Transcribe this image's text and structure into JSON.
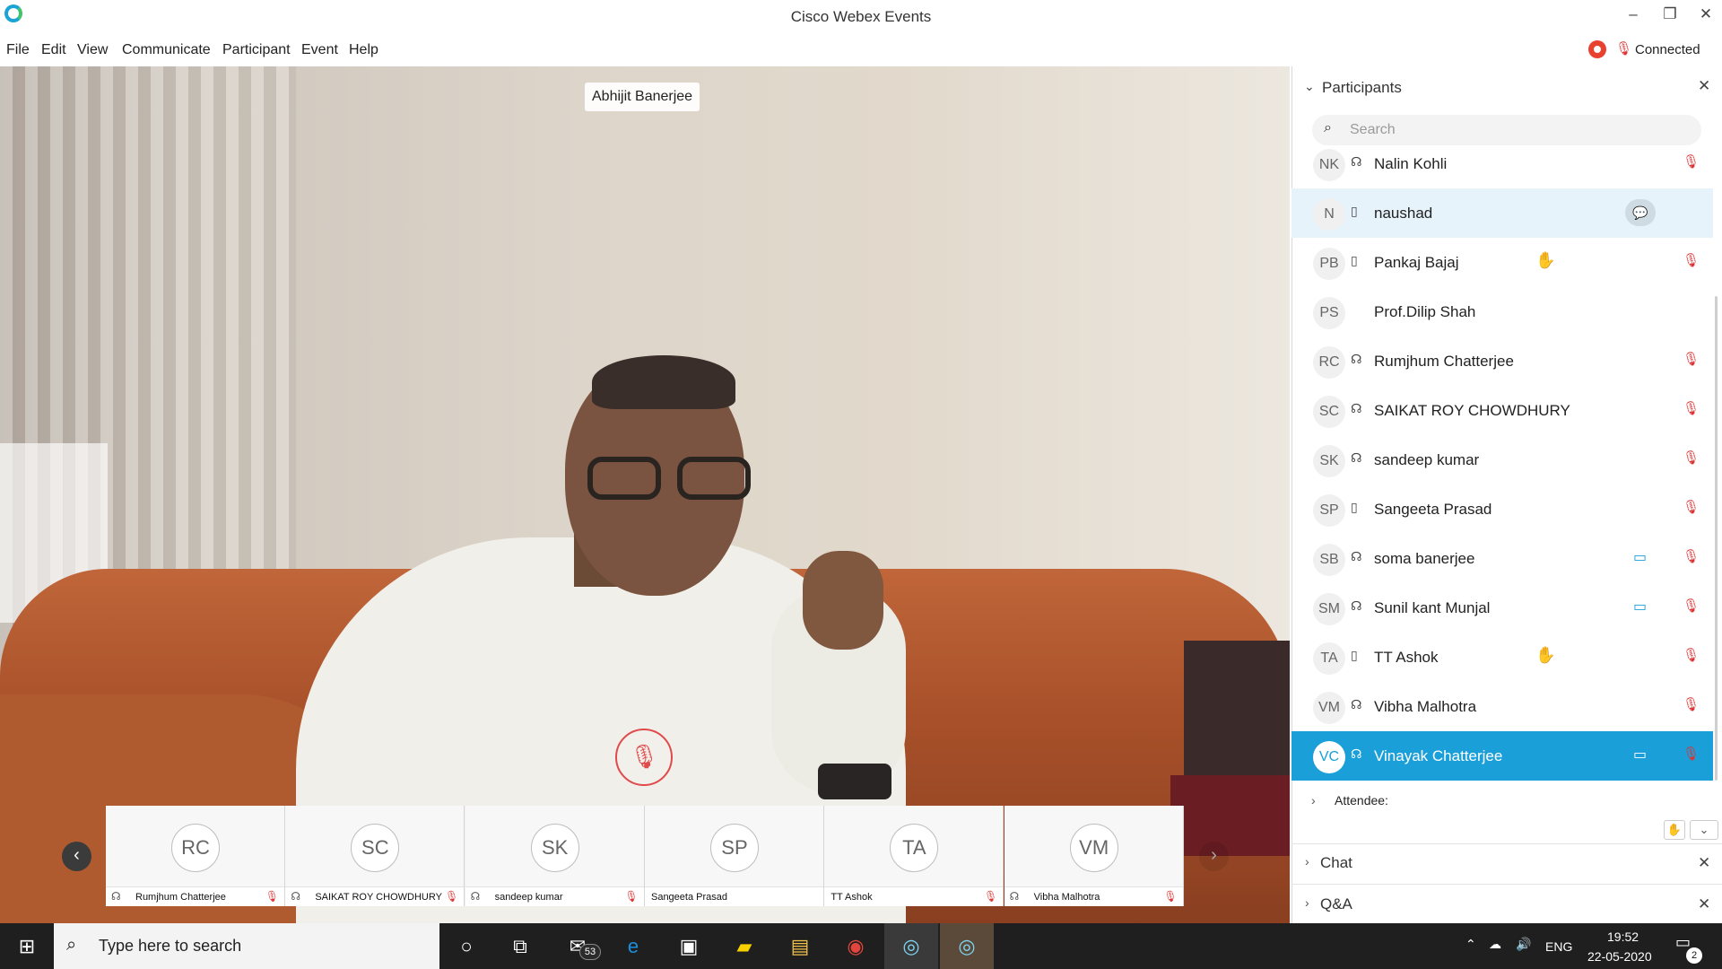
{
  "window": {
    "title": "Cisco Webex Events",
    "minimize": "–",
    "maximize": "❐",
    "close": "✕"
  },
  "menu": [
    "File",
    "Edit",
    "View",
    "Communicate",
    "Participant",
    "Event",
    "Help"
  ],
  "status": {
    "connection": "Connected"
  },
  "video": {
    "speaker_name": "Abhijit Banerjee",
    "mute_icon": "mic-muted"
  },
  "filmstrip": {
    "prev": "‹",
    "next": "›",
    "tiles": [
      {
        "initials": "RC",
        "name": "Rumjhum Chatterjee",
        "audio": "☊",
        "mic": "🎙"
      },
      {
        "initials": "SC",
        "name": "SAIKAT ROY CHOWDHURY",
        "audio": "☊",
        "mic": "🎙"
      },
      {
        "initials": "SK",
        "name": "sandeep kumar",
        "audio": "☊",
        "mic": "🎙"
      },
      {
        "initials": "SP",
        "name": "Sangeeta Prasad",
        "audio": "",
        "mic": ""
      },
      {
        "initials": "TA",
        "name": "TT Ashok",
        "audio": "",
        "mic": "🎙"
      },
      {
        "initials": "VM",
        "name": "Vibha Malhotra",
        "audio": "☊",
        "mic": "🎙"
      }
    ]
  },
  "participants_panel": {
    "title": "Participants",
    "search_placeholder": "Search",
    "participants": [
      {
        "initials": "NK",
        "name": "Nalin Kohli",
        "device": "☊",
        "hand": "",
        "video": "",
        "mic": "🎙",
        "chat": ""
      },
      {
        "initials": "N",
        "name": "naushad",
        "device": "▯",
        "hand": "",
        "video": "",
        "mic": "",
        "chat": "💬"
      },
      {
        "initials": "PB",
        "name": "Pankaj Bajaj",
        "device": "▯",
        "hand": "✋",
        "video": "",
        "mic": "🎙",
        "chat": ""
      },
      {
        "initials": "PS",
        "name": "Prof.Dilip Shah",
        "device": "",
        "hand": "",
        "video": "",
        "mic": "",
        "chat": ""
      },
      {
        "initials": "RC",
        "name": "Rumjhum Chatterjee",
        "device": "☊",
        "hand": "",
        "video": "",
        "mic": "🎙",
        "chat": ""
      },
      {
        "initials": "SC",
        "name": "SAIKAT ROY CHOWDHURY",
        "device": "☊",
        "hand": "",
        "video": "",
        "mic": "🎙",
        "chat": ""
      },
      {
        "initials": "SK",
        "name": "sandeep kumar",
        "device": "☊",
        "hand": "",
        "video": "",
        "mic": "🎙",
        "chat": ""
      },
      {
        "initials": "SP",
        "name": "Sangeeta Prasad",
        "device": "▯",
        "hand": "",
        "video": "",
        "mic": "🎙",
        "chat": ""
      },
      {
        "initials": "SB",
        "name": "soma banerjee",
        "device": "☊",
        "hand": "",
        "video": "▭",
        "mic": "🎙",
        "chat": ""
      },
      {
        "initials": "SM",
        "name": "Sunil kant Munjal",
        "device": "☊",
        "hand": "",
        "video": "▭",
        "mic": "🎙",
        "chat": ""
      },
      {
        "initials": "TA",
        "name": "TT Ashok",
        "device": "▯",
        "hand": "✋",
        "video": "",
        "mic": "🎙",
        "chat": ""
      },
      {
        "initials": "VM",
        "name": "Vibha Malhotra",
        "device": "☊",
        "hand": "",
        "video": "",
        "mic": "🎙",
        "chat": ""
      },
      {
        "initials": "VC",
        "name": "Vinayak Chatterjee",
        "device": "☊",
        "hand": "",
        "video": "▭",
        "mic": "🎙",
        "chat": ""
      }
    ],
    "attendee_label": "Attendee:"
  },
  "sections": [
    {
      "label": "Chat"
    },
    {
      "label": "Q&A"
    }
  ],
  "taskbar": {
    "search_placeholder": "Type here to search",
    "mail_badge": "53",
    "language": "ENG",
    "time": "19:52",
    "date": "22-05-2020",
    "notifications": "2"
  },
  "colors": {
    "accent": "#1a9fd9",
    "muted": "#d33333",
    "taskbar": "#1f1f1f"
  }
}
